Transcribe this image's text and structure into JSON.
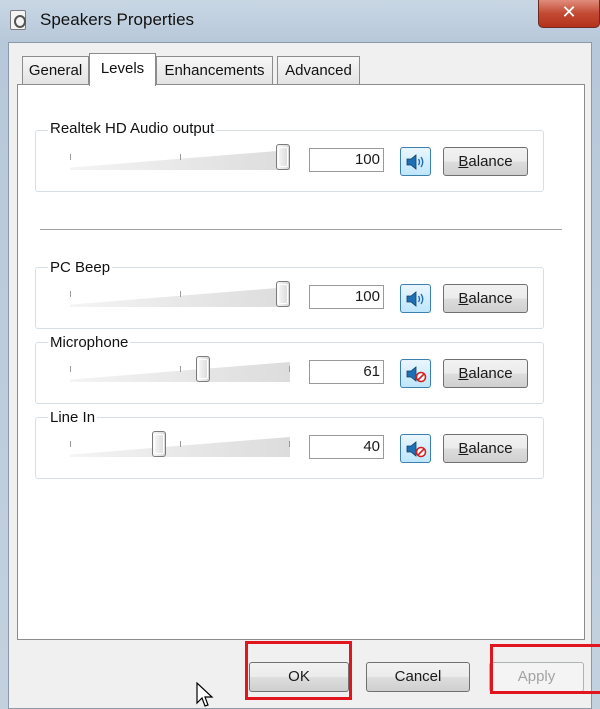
{
  "window": {
    "title": "Speakers Properties",
    "close_label": "✕"
  },
  "tabs": [
    {
      "label": "General",
      "active": false
    },
    {
      "label": "Levels",
      "active": true
    },
    {
      "label": "Enhancements",
      "active": false
    },
    {
      "label": "Advanced",
      "active": false
    }
  ],
  "levels": [
    {
      "label": "Realtek HD Audio output",
      "value": "100",
      "level": 1.0,
      "muted": false,
      "balance_label": "Balance",
      "balance_mnemonic": "B",
      "balance_rest": "alance"
    },
    {
      "label": "PC Beep",
      "value": "100",
      "level": 1.0,
      "muted": false,
      "balance_label": "Balance",
      "balance_mnemonic": "B",
      "balance_rest": "alance"
    },
    {
      "label": "Microphone",
      "value": "61",
      "level": 0.61,
      "muted": true,
      "balance_label": "Balance",
      "balance_mnemonic": "B",
      "balance_rest": "alance"
    },
    {
      "label": "Line In",
      "value": "40",
      "level": 0.4,
      "muted": true,
      "balance_label": "Balance",
      "balance_mnemonic": "B",
      "balance_rest": "alance"
    }
  ],
  "buttons": {
    "ok": "OK",
    "cancel": "Cancel",
    "apply": "Apply"
  },
  "colors": {
    "highlight": "#e0151d",
    "speaker_blue": "#1f6fb5",
    "mute_red": "#d42020"
  },
  "icons": {
    "speaker": "speaker-icon",
    "muted_speaker": "speaker-muted-icon",
    "window": "speaker-properties-icon"
  }
}
